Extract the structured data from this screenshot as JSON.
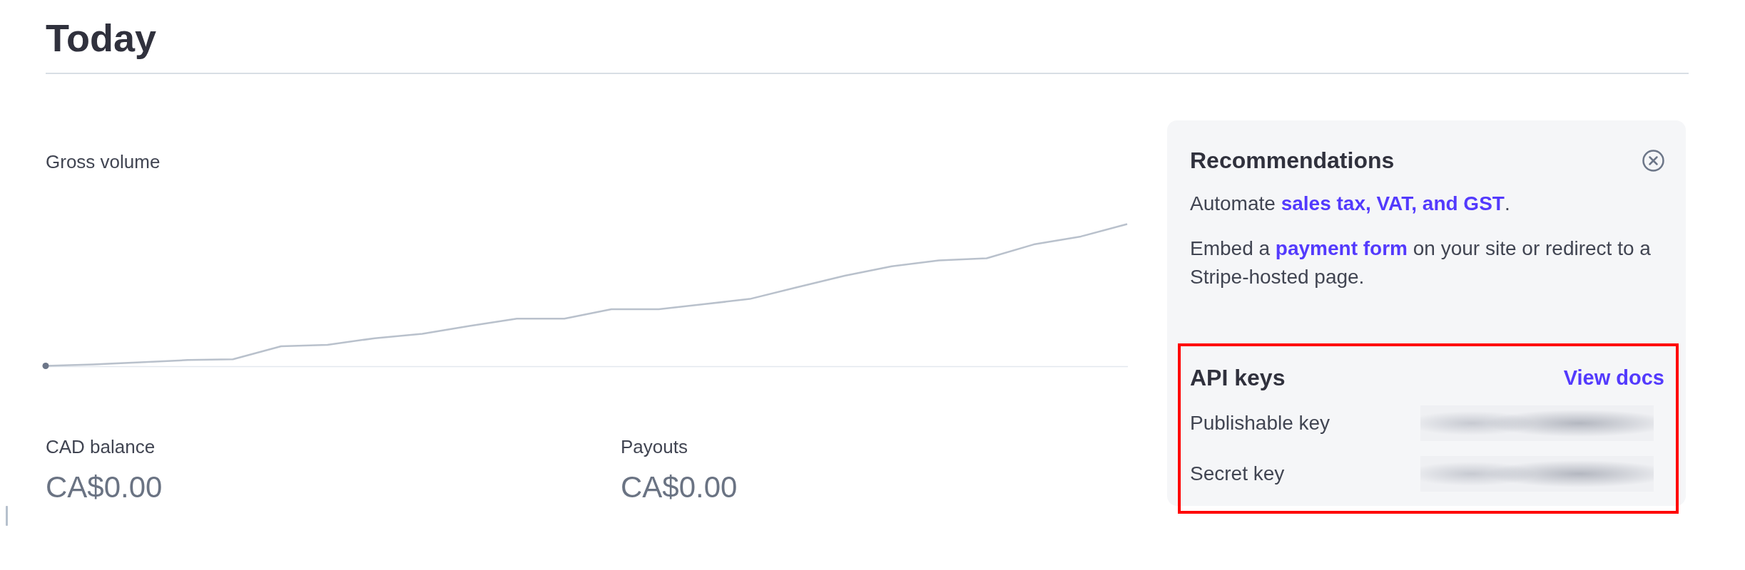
{
  "page": {
    "title": "Today"
  },
  "gross_volume": {
    "title": "Gross volume"
  },
  "balances": [
    {
      "label": "CAD balance",
      "value": "CA$0.00"
    },
    {
      "label": "Payouts",
      "value": "CA$0.00"
    }
  ],
  "recommendations": {
    "title": "Recommendations",
    "paragraphs": [
      {
        "parts": [
          {
            "kind": "text",
            "text": "Automate "
          },
          {
            "kind": "link",
            "text": "sales tax, VAT, and GST"
          },
          {
            "kind": "text",
            "text": "."
          }
        ]
      },
      {
        "parts": [
          {
            "kind": "text",
            "text": "Embed a "
          },
          {
            "kind": "link",
            "text": "payment form"
          },
          {
            "kind": "text",
            "text": " on your site or redirect to a Stripe-hosted page."
          }
        ]
      }
    ]
  },
  "api_keys": {
    "title": "API keys",
    "highlighted": true,
    "docs_link": "View docs",
    "keys": [
      {
        "label": "Publishable key"
      },
      {
        "label": "Secret key"
      }
    ]
  }
}
